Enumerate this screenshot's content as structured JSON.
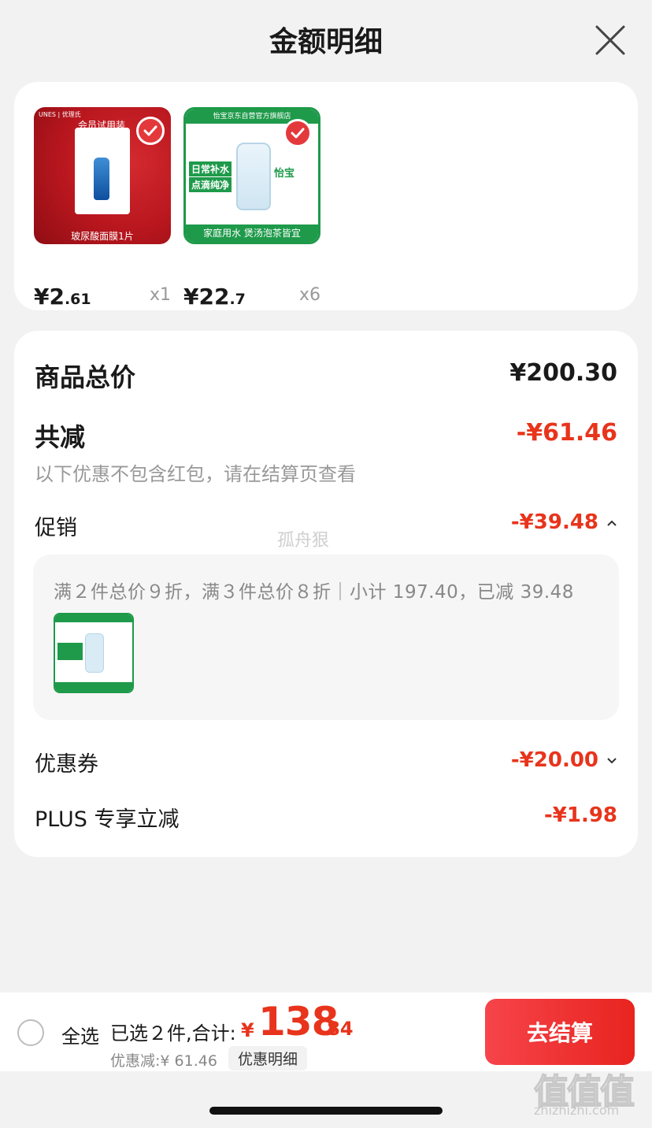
{
  "header": {
    "title": "金额明细"
  },
  "products": [
    {
      "thumb_brand": "UNES | 优理氏",
      "thumb_tag": "会员试用装",
      "thumb_caption": "玻尿酸面膜1片",
      "price_int": "¥2",
      "price_dec": ".61",
      "qty": "x1"
    },
    {
      "thumb_banner": "怡宝京东自营官方旗舰店",
      "thumb_line1": "日常补水",
      "thumb_line2": "点滴纯净",
      "thumb_brand": "怡宝",
      "thumb_caption": "家庭用水 煲汤泡茶皆宜",
      "price_int": "¥22",
      "price_dec": ".7",
      "qty": "x6"
    }
  ],
  "summary": {
    "subtotal_label": "商品总价",
    "subtotal_value": "¥200.30",
    "reduce_label": "共减",
    "reduce_value": "-¥61.46",
    "reduce_note": "以下优惠不包含红包，请在结算页查看",
    "promo_label": "促销",
    "promo_value": "-¥39.48",
    "promo_detail": "满２件总价９折，满３件总价８折｜小计 197.40，已减 39.48",
    "coupon_label": "优惠券",
    "coupon_value": "-¥20.00",
    "plus_label": "PLUS 专享立减",
    "plus_value": "-¥1.98"
  },
  "watermark": "孤舟狠",
  "bottom_bar": {
    "select_all": "全选",
    "selected_text": "已选２件,合计:",
    "total_symbol": "¥",
    "total_int": "138",
    "total_dec": ".84",
    "discount_text": "优惠减:¥ 61.46",
    "detail_link": "优惠明细",
    "checkout": "去结算"
  },
  "site_watermark": {
    "logo": "值值值",
    "url": "zhizhizhi.com"
  },
  "colors": {
    "accent_red": "#e8341c",
    "checkout_red": "#f6444a",
    "product1_bg": "#b8161e",
    "product2_green": "#1e9a4a"
  },
  "icons": {
    "close": "close-icon",
    "check": "check-icon",
    "chevron_up": "chevron-up-icon",
    "chevron_down": "chevron-down-icon"
  }
}
